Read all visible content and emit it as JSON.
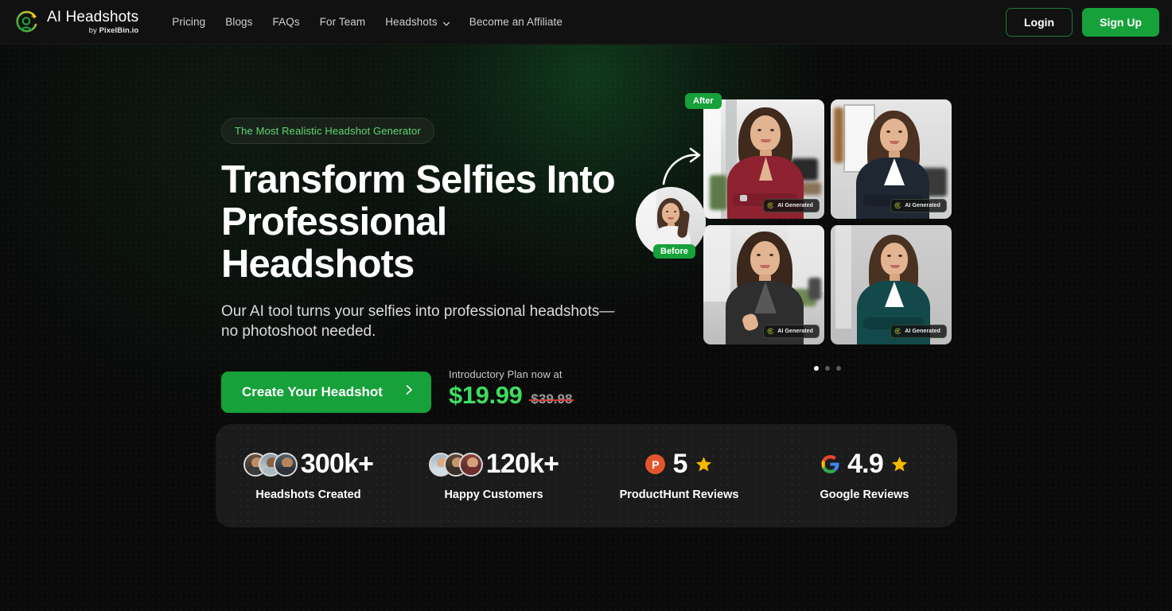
{
  "nav": {
    "brand": {
      "title": "AI Headshots",
      "sub_prefix": "by ",
      "sub_brand": "PixelBin.io",
      "logo_icon": "pixelbin-logo-icon"
    },
    "links": [
      {
        "label": "Pricing",
        "has_dropdown": false
      },
      {
        "label": "Blogs",
        "has_dropdown": false
      },
      {
        "label": "FAQs",
        "has_dropdown": false
      },
      {
        "label": "For Team",
        "has_dropdown": false
      },
      {
        "label": "Headshots",
        "has_dropdown": true,
        "icon": "chevron-down-icon"
      },
      {
        "label": "Become an Affiliate",
        "has_dropdown": false
      }
    ],
    "login_label": "Login",
    "signup_label": "Sign Up"
  },
  "hero": {
    "pill": "The Most Realistic Headshot Generator",
    "heading": "Transform Selfies Into Professional Headshots",
    "subheading": "Our AI tool turns your selfies into professional headshots—no photoshoot needed.",
    "cta_label": "Create Your Headshot",
    "cta_icon": "chevron-right-icon",
    "price_label": "Introductory Plan now at",
    "price_new": "$19.99",
    "price_old": "$39.98"
  },
  "gallery": {
    "after_tag": "After",
    "before_tag": "Before",
    "arrow_icon": "curved-arrow-icon",
    "badge_label": "AI Generated",
    "badge_icon": "pixelbin-logo-icon",
    "items": [
      {
        "alt": "woman in red blouse office headshot"
      },
      {
        "alt": "woman in navy blazer office headshot"
      },
      {
        "alt": "woman in grey shirt street headshot"
      },
      {
        "alt": "woman in teal blazer studio headshot"
      }
    ],
    "dots": [
      {
        "active": true
      },
      {
        "active": false
      },
      {
        "active": false
      }
    ]
  },
  "stats": [
    {
      "value": "300k+",
      "label": "Headshots Created",
      "icon": "avatar-stack-icon"
    },
    {
      "value": "120k+",
      "label": "Happy Customers",
      "icon": "avatar-stack-icon"
    },
    {
      "value": "5",
      "label": "ProductHunt Reviews",
      "icon": "producthunt-icon",
      "star_icon": "star-icon"
    },
    {
      "value": "4.9",
      "label": "Google Reviews",
      "icon": "google-icon",
      "star_icon": "star-icon"
    }
  ],
  "colors": {
    "background": "#0a0a0a",
    "nav_background": "#111111",
    "brand_green": "#17a13a",
    "accent_green": "#3ddc5f",
    "pill_text": "#5fd873",
    "card_background": "#1b1b1b",
    "strike_red": "#d63c3c",
    "star_gold": "#f5b800",
    "producthunt_orange": "#e1562d"
  }
}
